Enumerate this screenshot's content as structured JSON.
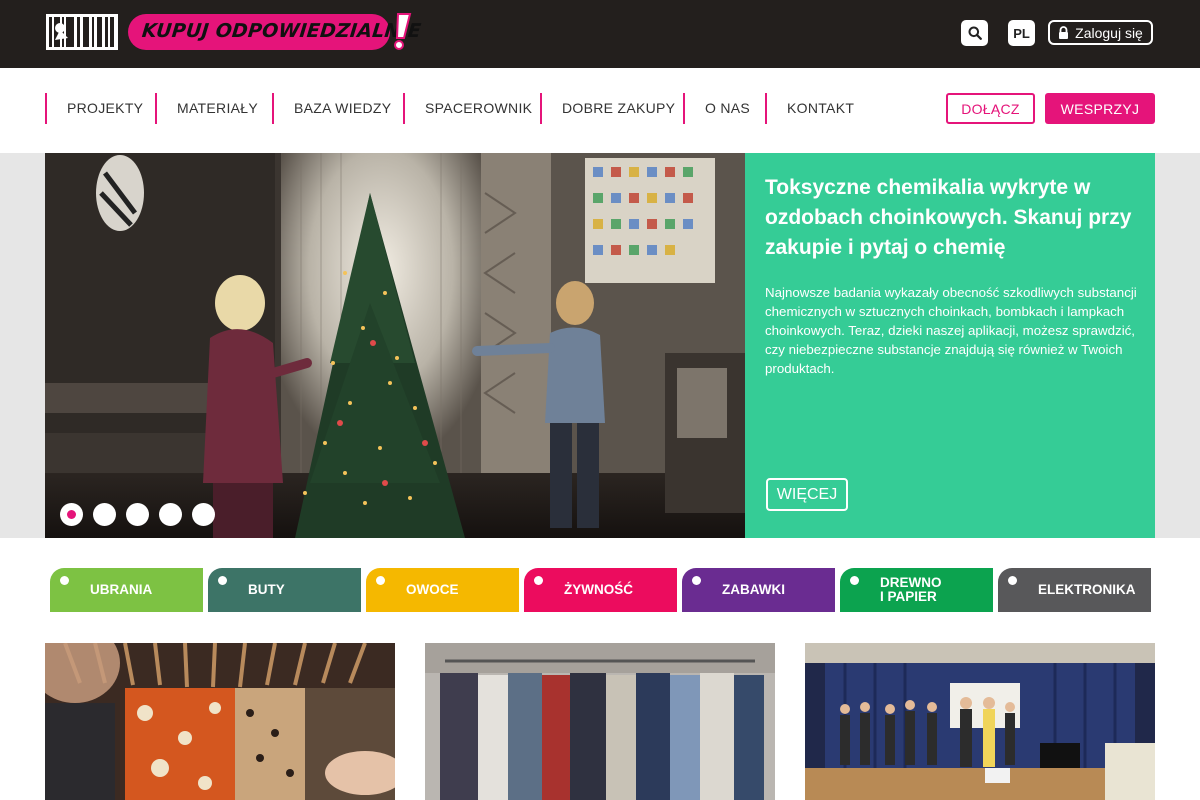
{
  "header": {
    "logo_text": "KUPUJ ODPOWIEDZIALNIE",
    "logo_exclaim": "!",
    "language": "PL",
    "login_label": "Zaloguj się"
  },
  "nav": {
    "items": [
      "PROJEKTY",
      "MATERIAŁY",
      "BAZA WIEDZY",
      "SPACEROWNIK",
      "DOBRE ZAKUPY",
      "O NAS",
      "KONTAKT"
    ],
    "join_label": "DOŁĄCZ",
    "support_label": "WESPRZYJ"
  },
  "hero": {
    "title": "Toksyczne chemikalia wykryte w ozdobach choinkowych. Skanuj przy zakupie i pytaj o chemię",
    "text": "Najnowsze badania wykazały obecność szkodliwych substancji chemicznych w sztucznych choinkach, bombkach i lampkach choinkowych. Teraz, dzieki naszej aplikacji, możesz sprawdzić, czy niebezpieczne substancje znajdują się również w Twoich produktach.",
    "more_label": "WIĘCEJ",
    "slides_count": 5,
    "active_slide": 1
  },
  "categories": [
    {
      "label": "UBRANIA",
      "color": "#7dc243"
    },
    {
      "label": "BUTY",
      "color": "#3d7467"
    },
    {
      "label": "OWOCE",
      "color": "#f5b800"
    },
    {
      "label": "ŻYWNOŚĆ",
      "color": "#ec0c5e"
    },
    {
      "label": "ZABAWKI",
      "color": "#6a2c91"
    },
    {
      "label": "DREWNO\nI PAPIER",
      "color": "#0ca34f"
    },
    {
      "label": "ELEKTRONIKA",
      "color": "#58585a"
    }
  ],
  "colors": {
    "accent": "#e5147a",
    "topbar": "#231f1d",
    "hero_panel": "#35cc96"
  },
  "icons": {
    "search": "search-icon",
    "lock": "lock-icon"
  }
}
